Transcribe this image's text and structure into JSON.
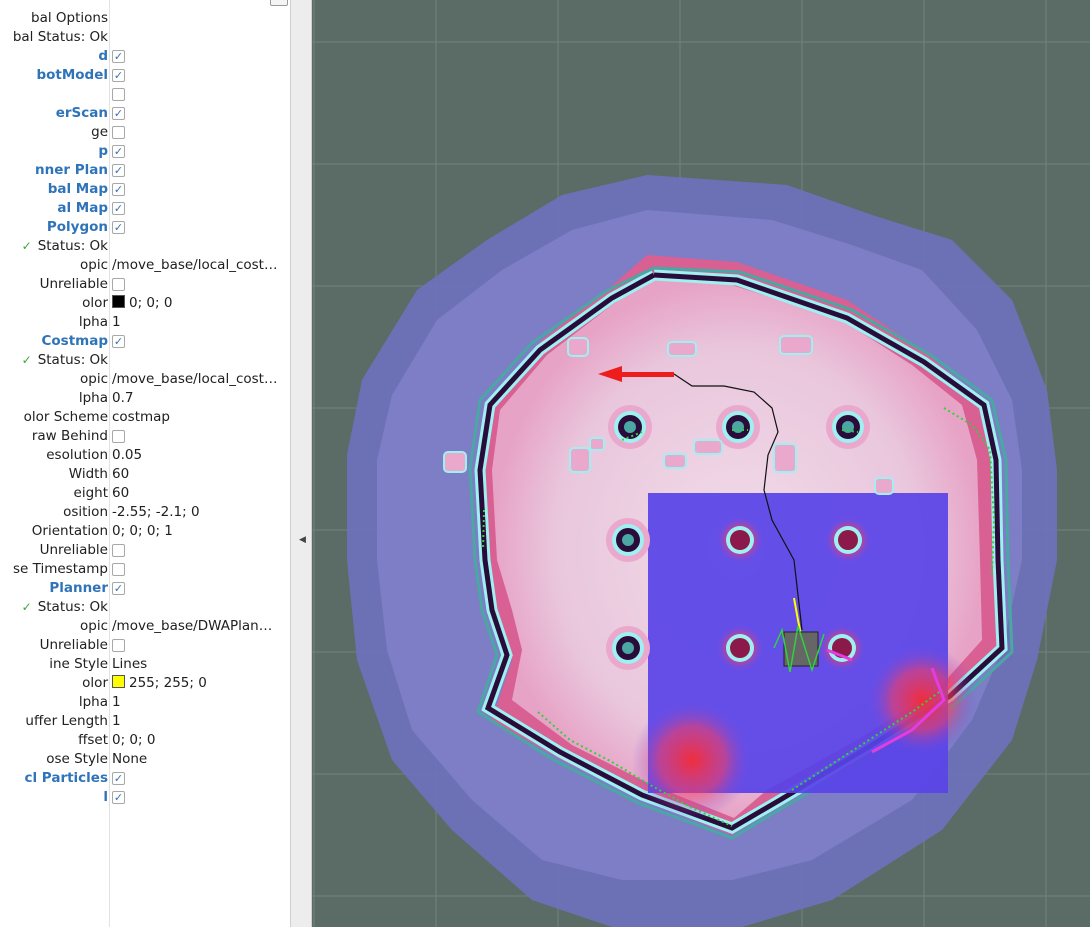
{
  "panel": {
    "title": "",
    "rows": [
      {
        "name": "bal Options",
        "kind": "text"
      },
      {
        "name": "bal Status: Ok",
        "kind": "text"
      },
      {
        "name": "d",
        "kind": "display",
        "checked": true
      },
      {
        "name": "botModel",
        "kind": "display",
        "checked": true
      },
      {
        "name": "",
        "kind": "display",
        "checked": false
      },
      {
        "name": "erScan",
        "kind": "display",
        "checked": true
      },
      {
        "name": "ge",
        "kind": "text",
        "checked": false
      },
      {
        "name": "p",
        "kind": "display",
        "checked": true
      },
      {
        "name": "nner Plan",
        "kind": "display",
        "checked": true
      },
      {
        "name": "bal Map",
        "kind": "display",
        "checked": true
      },
      {
        "name": "al Map",
        "kind": "display",
        "checked": true
      },
      {
        "name": "Polygon",
        "kind": "display",
        "checked": true
      },
      {
        "name": "Status: Ok",
        "kind": "status"
      },
      {
        "name": "opic",
        "kind": "text",
        "value": "/move_base/local_cost…"
      },
      {
        "name": "Unreliable",
        "kind": "text",
        "checked": false
      },
      {
        "name": "olor",
        "kind": "text",
        "value": "0; 0; 0",
        "swatch": "#000000"
      },
      {
        "name": "lpha",
        "kind": "text",
        "value": "1"
      },
      {
        "name": "Costmap",
        "kind": "display",
        "checked": true
      },
      {
        "name": "Status: Ok",
        "kind": "status"
      },
      {
        "name": "opic",
        "kind": "text",
        "value": "/move_base/local_cost…"
      },
      {
        "name": "lpha",
        "kind": "text",
        "value": "0.7"
      },
      {
        "name": "olor Scheme",
        "kind": "text",
        "value": "costmap"
      },
      {
        "name": "raw Behind",
        "kind": "text",
        "checked": false
      },
      {
        "name": "esolution",
        "kind": "text",
        "value": "0.05"
      },
      {
        "name": "Width",
        "kind": "text",
        "value": "60"
      },
      {
        "name": "eight",
        "kind": "text",
        "value": "60"
      },
      {
        "name": "osition",
        "kind": "text",
        "value": "-2.55; -2.1; 0"
      },
      {
        "name": "Orientation",
        "kind": "text",
        "value": "0; 0; 0; 1"
      },
      {
        "name": "Unreliable",
        "kind": "text",
        "checked": false
      },
      {
        "name": "se Timestamp",
        "kind": "text",
        "checked": false
      },
      {
        "name": "Planner",
        "kind": "display",
        "checked": true
      },
      {
        "name": "Status: Ok",
        "kind": "status"
      },
      {
        "name": "opic",
        "kind": "text",
        "value": "/move_base/DWAPlan…"
      },
      {
        "name": "Unreliable",
        "kind": "text",
        "checked": false
      },
      {
        "name": "ine Style",
        "kind": "text",
        "value": "Lines"
      },
      {
        "name": "olor",
        "kind": "text",
        "value": "255; 255; 0",
        "swatch": "#ffff00"
      },
      {
        "name": "lpha",
        "kind": "text",
        "value": "1"
      },
      {
        "name": "uffer Length",
        "kind": "text",
        "value": "1"
      },
      {
        "name": "ffset",
        "kind": "text",
        "value": "0; 0; 0"
      },
      {
        "name": "ose Style",
        "kind": "text",
        "value": "None"
      },
      {
        "name": "cl Particles",
        "kind": "display",
        "checked": true
      },
      {
        "name": "l",
        "kind": "display",
        "checked": true
      }
    ]
  },
  "colors": {
    "viewport_bg": "#5b6c66",
    "display_name": "#2f73b8",
    "status_ok": "#39a83a",
    "global_costmap_outer": "#6e72bb",
    "local_costmap": "#4d3ae6",
    "lethal": "#2a0c3a",
    "inflated": "#9ff0f0"
  },
  "icons": {
    "status": "check-icon",
    "splitter": "triangle-left-icon"
  }
}
